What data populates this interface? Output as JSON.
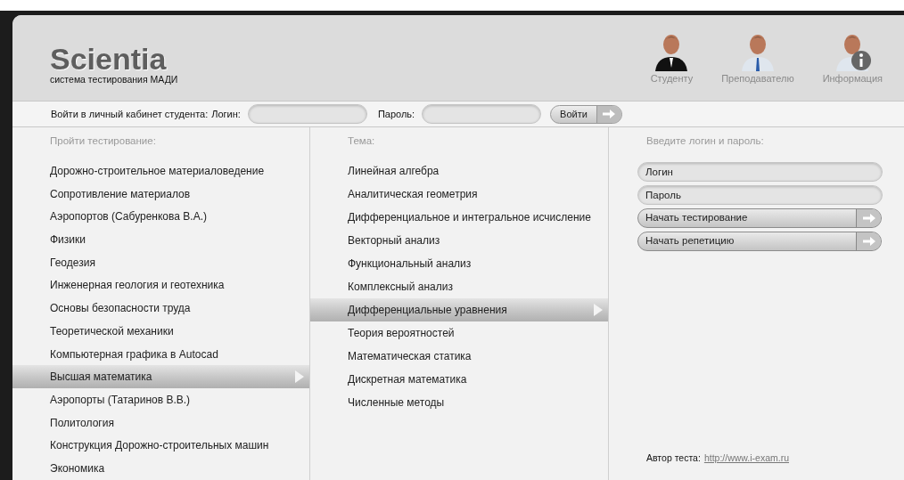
{
  "header": {
    "logo": "Scientia",
    "subtitle": "система тестирования МАДИ",
    "nav": [
      {
        "label": "Студенту",
        "kind": "student"
      },
      {
        "label": "Преподавателю",
        "kind": "teacher"
      },
      {
        "label": "Информация",
        "kind": "info"
      }
    ]
  },
  "login_bar": {
    "caption": "Войти в личный кабинет студента:",
    "login_label": "Логин:",
    "password_label": "Пароль:",
    "button": "Войти"
  },
  "subjects": {
    "heading": "Пройти тестирование:",
    "items": [
      {
        "label": "Дорожно-строительное материаловедение",
        "selected": false
      },
      {
        "label": "Сопротивление материалов",
        "selected": false
      },
      {
        "label": "Аэропортов (Сабуренкова В.А.)",
        "selected": false
      },
      {
        "label": "Физики",
        "selected": false
      },
      {
        "label": "Геодезия",
        "selected": false
      },
      {
        "label": "Инженерная геология и геотехника",
        "selected": false
      },
      {
        "label": "Основы безопасности труда",
        "selected": false
      },
      {
        "label": "Теоретической механики",
        "selected": false
      },
      {
        "label": "Компьютерная графика в Autocad",
        "selected": false
      },
      {
        "label": "Высшая математика",
        "selected": true
      },
      {
        "label": "Аэропорты (Татаринов В.В.)",
        "selected": false
      },
      {
        "label": "Политология",
        "selected": false
      },
      {
        "label": "Конструкция Дорожно-строительных машин",
        "selected": false
      },
      {
        "label": "Экономика",
        "selected": false
      }
    ]
  },
  "topics": {
    "heading": "Тема:",
    "items": [
      {
        "label": "Линейная алгебра",
        "selected": false
      },
      {
        "label": "Аналитическая геометрия",
        "selected": false
      },
      {
        "label": "Дифференциальное и интегральное исчисление",
        "selected": false
      },
      {
        "label": "Векторный анализ",
        "selected": false
      },
      {
        "label": "Функциональный анализ",
        "selected": false
      },
      {
        "label": "Комплексный анализ",
        "selected": false
      },
      {
        "label": "Дифференциальные уравнения",
        "selected": true
      },
      {
        "label": "Теория вероятностей",
        "selected": false
      },
      {
        "label": "Математическая статика",
        "selected": false
      },
      {
        "label": "Дискретная математика",
        "selected": false
      },
      {
        "label": "Численные методы",
        "selected": false
      }
    ]
  },
  "start_panel": {
    "heading": "Введите логин и пароль:",
    "login_placeholder": "Логин",
    "password_placeholder": "Пароль",
    "buttons": [
      "Начать тестирование",
      "Начать репетицию"
    ],
    "author_label": "Автор теста:",
    "author_link": "http://www.i-exam.ru"
  }
}
